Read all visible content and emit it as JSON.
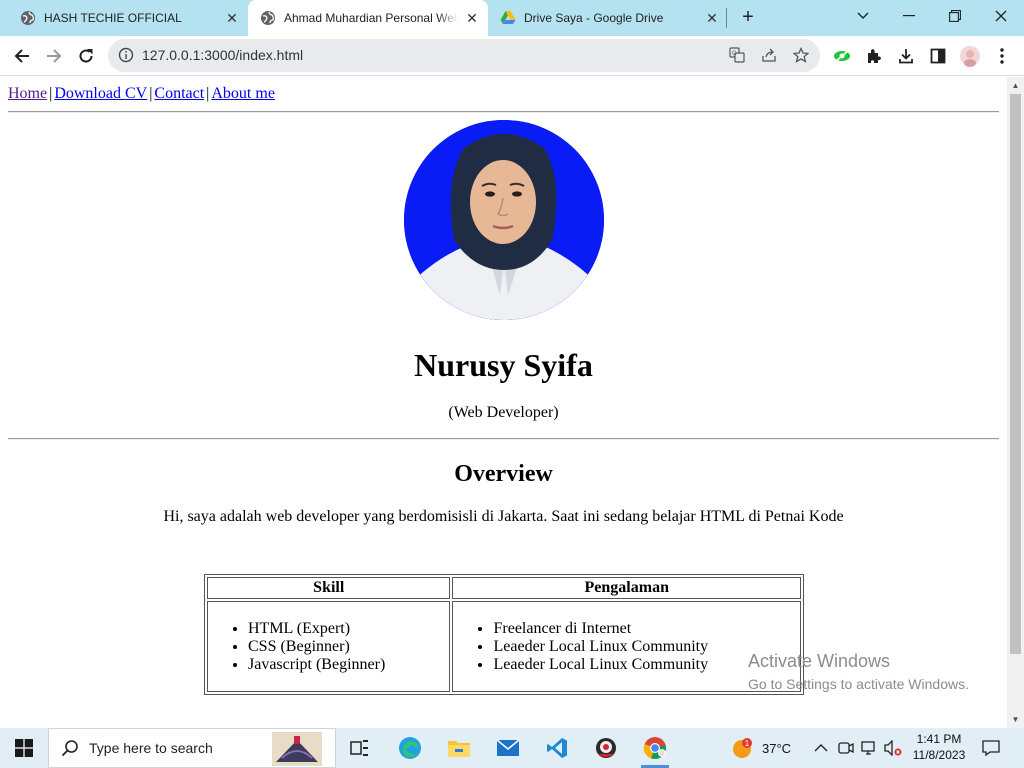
{
  "browser": {
    "tabs": [
      {
        "title": "HASH TECHIE OFFICIAL",
        "favicon": "globe-icon",
        "active": false
      },
      {
        "title": "Ahmad Muhardian Personal Website",
        "favicon": "globe-icon",
        "active": true
      },
      {
        "title": "Drive Saya - Google Drive",
        "favicon": "google-drive-icon",
        "active": false
      }
    ],
    "address": "127.0.0.1:3000/index.html"
  },
  "page": {
    "nav": [
      {
        "label": "Home",
        "visited": true
      },
      {
        "label": "Download CV",
        "visited": false
      },
      {
        "label": "Contact",
        "visited": false
      },
      {
        "label": "About me",
        "visited": false
      }
    ],
    "nav_separator": "|",
    "name": "Nurusy Syifa",
    "role": "(Web Developer)",
    "overview_title": "Overview",
    "overview_text": "Hi, saya adalah web developer yang berdomisisli di Jakarta. Saat ini sedang belajar HTML di Petnai Kode",
    "table": {
      "headers": [
        "Skill",
        "Pengalaman"
      ],
      "skills": [
        "HTML (Expert)",
        "CSS (Beginner)",
        "Javascript (Beginner)"
      ],
      "experience": [
        "Freelancer di Internet",
        "Leaeder Local Linux Community",
        "Leaeder Local Linux Community"
      ]
    },
    "watermark": {
      "line1": "Activate Windows",
      "line2": "Go to Settings to activate Windows."
    }
  },
  "taskbar": {
    "search_placeholder": "Type here to search",
    "weather": "37°C",
    "weather_badge": "1",
    "time": "1:41 PM",
    "date": "11/8/2023"
  },
  "colors": {
    "tabstrip": "#b5e2f0",
    "avatar_bg": "#0a1cf5",
    "link": "#0000ee",
    "visited_link": "#551a8b"
  }
}
